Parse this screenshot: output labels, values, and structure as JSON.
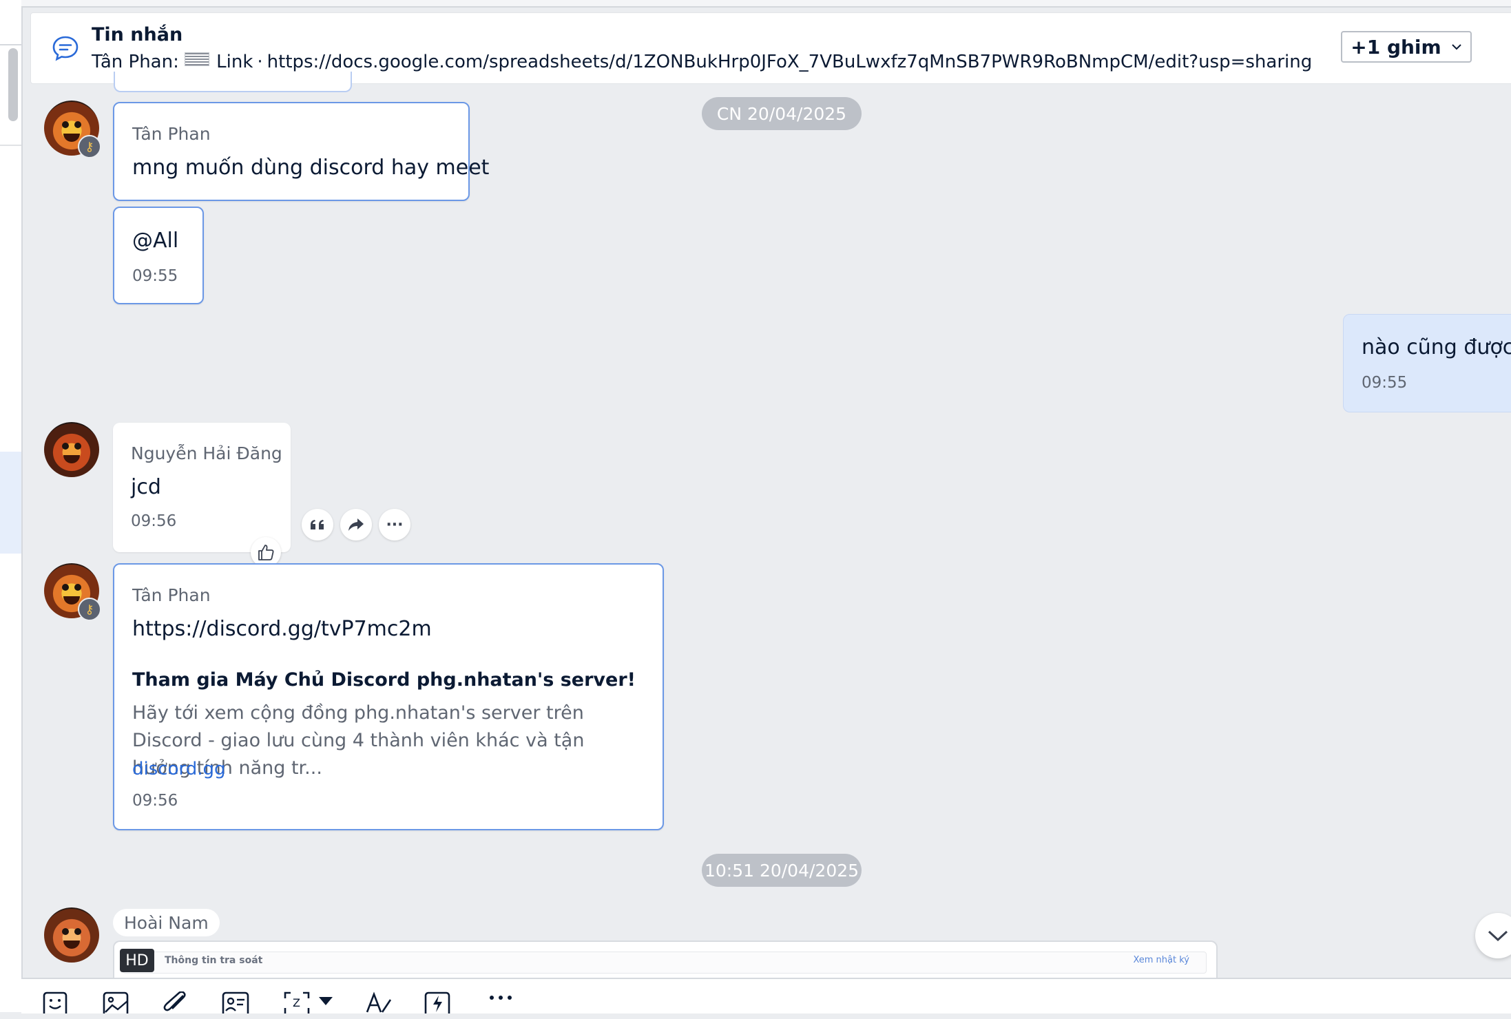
{
  "pinned": {
    "title": "Tin nhắn",
    "sender": "Tân Phan:",
    "type_label": "Link",
    "separator": "·",
    "url": "https://docs.google.com/spreadsheets/d/1ZONBukHrp0JFoX_7VBuLwxfz7qMnSB7PWR9RoBNmpCM/edit?usp=sharing",
    "pins_button": "+1 ghim",
    "more": "···"
  },
  "dates": {
    "first": "CN 20/04/2025",
    "second": "10:51 20/04/2025"
  },
  "messages": [
    {
      "sender": "Tân Phan",
      "text": "mng muốn dùng discord hay meet"
    },
    {
      "mention": "@All",
      "time": "09:55"
    },
    {
      "text": "nào cũng được",
      "time": "09:55"
    },
    {
      "sender": "Nguyễn Hải Đăng",
      "text": "jcd",
      "time": "09:56"
    },
    {
      "sender": "Tân Phan",
      "link": "https://discord.gg/tvP7mc2m",
      "preview_title": "Tham gia Máy Chủ Discord phg.nhatan's server!",
      "preview_desc": "Hãy tới xem cộng đồng phg.nhatan's server trên Discord - giao lưu cùng 4 thành viên khác và tận hưởng tính năng tr...",
      "preview_domain": "discord.gg",
      "time": "09:56"
    },
    {
      "sender": "Hoài Nam",
      "image_title": "Thông tin tra soát",
      "image_link": "Xem nhật ký",
      "badge": "HD"
    }
  ],
  "hover_actions": [
    "quote-icon",
    "forward-icon",
    "more-icon"
  ],
  "toolbar_icons": [
    "sticker-icon",
    "image-icon",
    "attachment-icon",
    "contact-card-icon",
    "screenshot-icon",
    "dropdown-icon",
    "text-format-icon",
    "quick-message-icon",
    "more-icon"
  ],
  "colors": {
    "background": "#ebedf0",
    "accent": "#2a6ad8",
    "own_bubble": "#dce8fb",
    "date_pill": "#bdc1c8"
  }
}
